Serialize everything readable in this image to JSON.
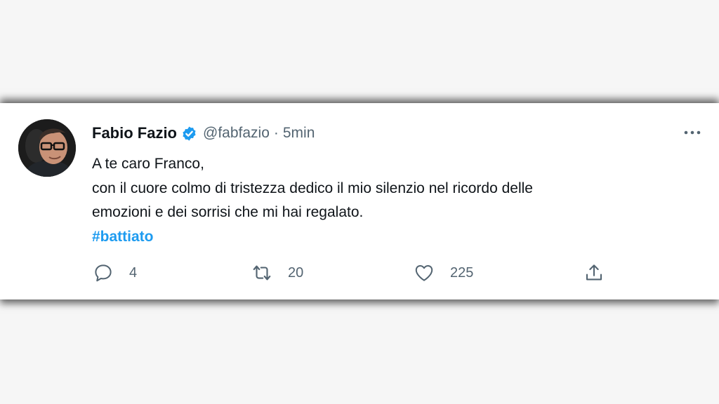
{
  "tweet": {
    "author_name": "Fabio Fazio",
    "handle": "@fabfazio",
    "separator": "·",
    "time": "5min",
    "text_lines": [
      "A te caro Franco,",
      "con il cuore colmo di tristezza dedico il mio silenzio nel ricordo delle",
      "emozioni e dei sorrisi che mi hai regalato."
    ],
    "hashtag": "#battiato"
  },
  "actions": {
    "reply_count": "4",
    "retweet_count": "20",
    "like_count": "225"
  },
  "icons": {
    "verified": "verified-badge-icon",
    "more": "more-icon",
    "reply": "reply-icon",
    "retweet": "retweet-icon",
    "like": "heart-icon",
    "share": "share-icon"
  },
  "colors": {
    "accent": "#1d9bf0",
    "text": "#0f1419",
    "secondary": "#536471",
    "page_background": "#f6f6f6",
    "card_background": "#ffffff"
  }
}
